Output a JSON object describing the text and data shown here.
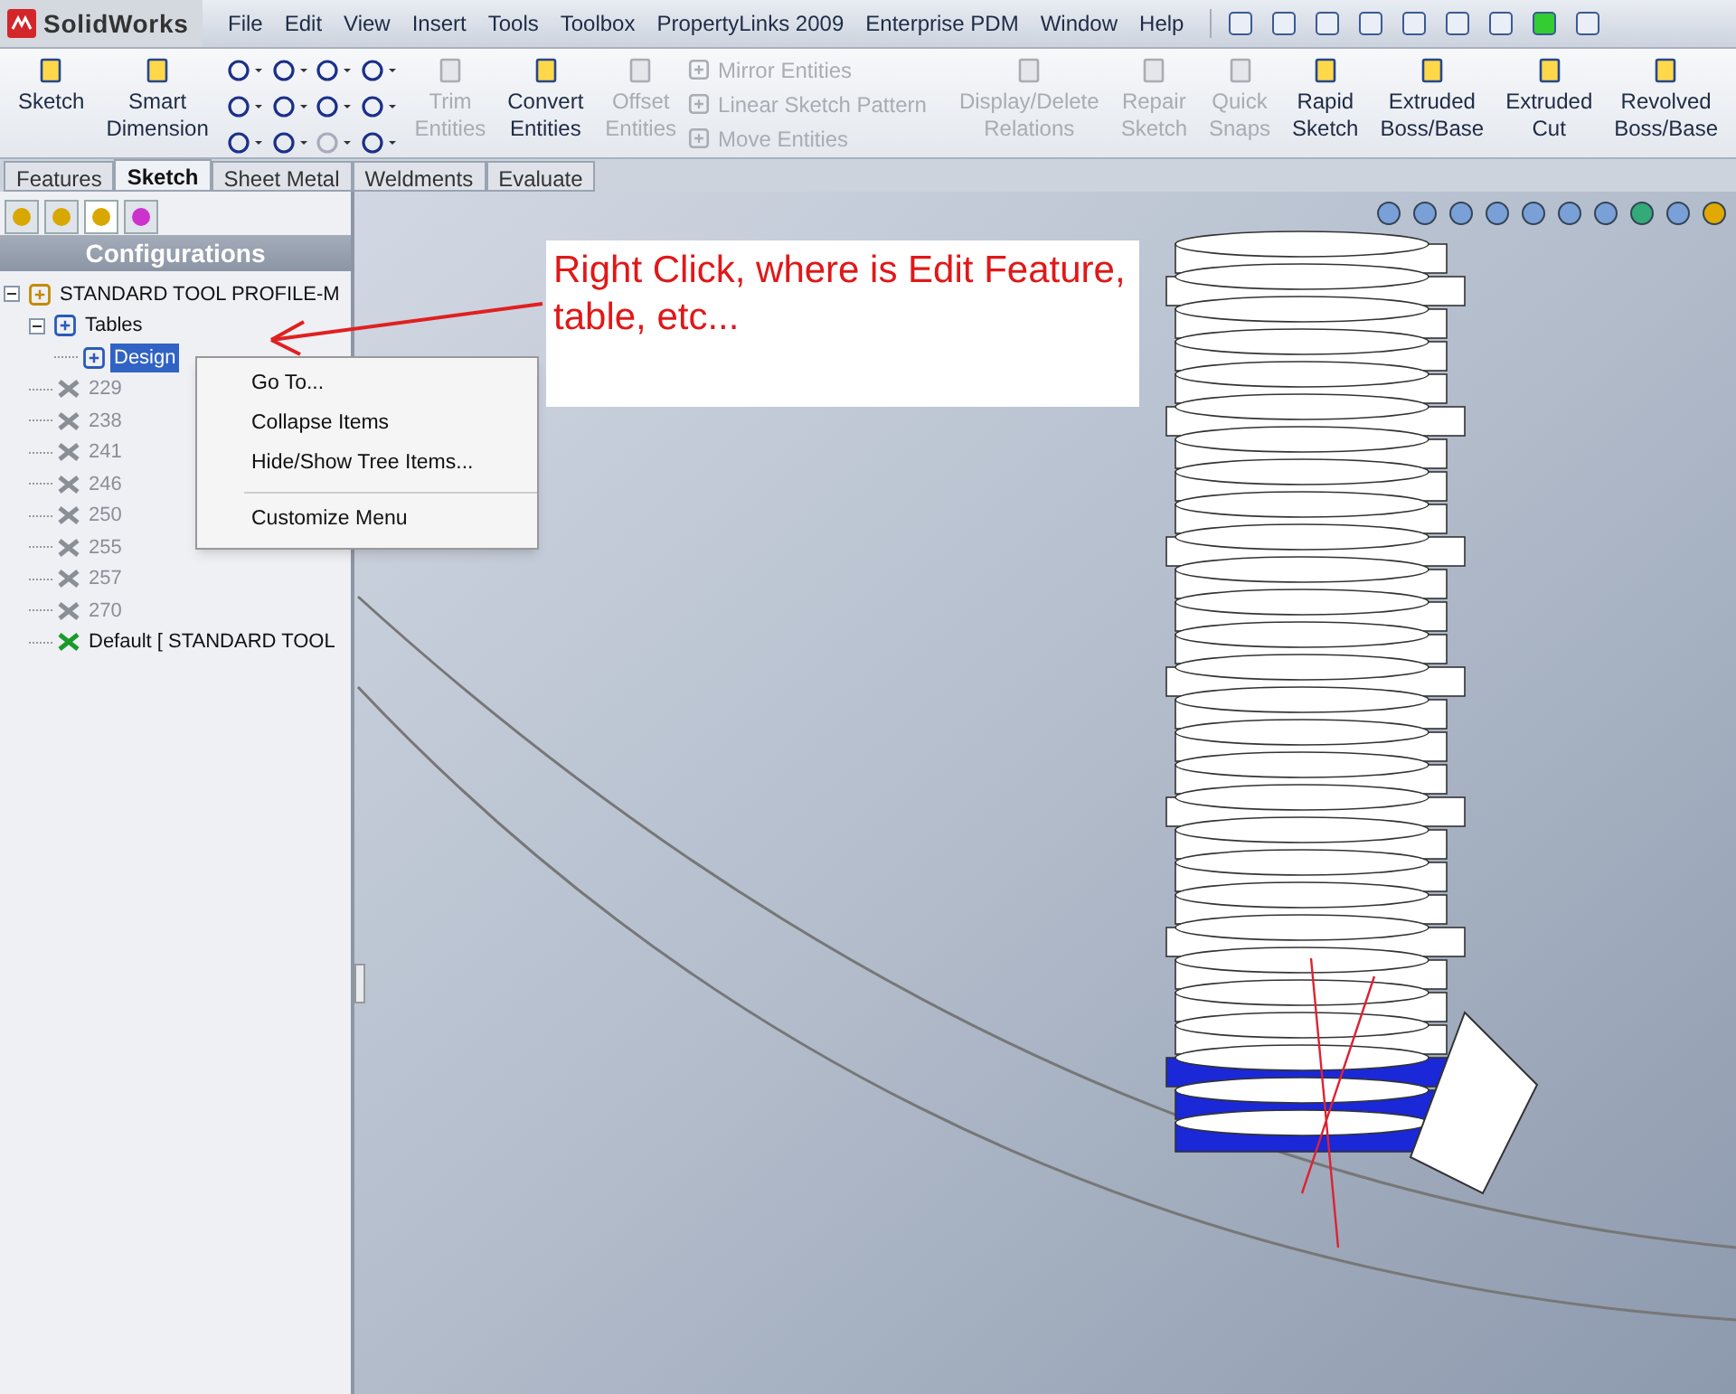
{
  "app": {
    "logo": "SolidWorks"
  },
  "menu": [
    "File",
    "Edit",
    "View",
    "Insert",
    "Tools",
    "Toolbox",
    "PropertyLinks 2009",
    "Enterprise PDM",
    "Window",
    "Help"
  ],
  "ribbon": [
    {
      "kind": "large",
      "label": "Sketch",
      "disabled": false
    },
    {
      "kind": "large",
      "label": "Smart\nDimension",
      "disabled": false
    },
    {
      "kind": "grid"
    },
    {
      "kind": "large",
      "label": "Trim\nEntities",
      "disabled": true
    },
    {
      "kind": "large",
      "label": "Convert\nEntities",
      "disabled": false
    },
    {
      "kind": "large",
      "label": "Offset\nEntities",
      "disabled": true
    },
    {
      "kind": "small",
      "items": [
        {
          "label": "Mirror Entities",
          "disabled": true
        },
        {
          "label": "Linear Sketch Pattern",
          "disabled": true
        },
        {
          "label": "Move Entities",
          "disabled": true
        }
      ]
    },
    {
      "kind": "large",
      "label": "Display/Delete\nRelations",
      "disabled": true
    },
    {
      "kind": "large",
      "label": "Repair\nSketch",
      "disabled": true
    },
    {
      "kind": "large",
      "label": "Quick\nSnaps",
      "disabled": true
    },
    {
      "kind": "large",
      "label": "Rapid\nSketch",
      "disabled": false
    },
    {
      "kind": "large",
      "label": "Extruded\nBoss/Base",
      "disabled": false
    },
    {
      "kind": "large",
      "label": "Extruded\nCut",
      "disabled": false
    },
    {
      "kind": "large",
      "label": "Revolved\nBoss/Base",
      "disabled": false
    }
  ],
  "tabs": [
    {
      "label": "Features",
      "selected": false
    },
    {
      "label": "Sketch",
      "selected": true
    },
    {
      "label": "Sheet Metal",
      "selected": false
    },
    {
      "label": "Weldments",
      "selected": false
    },
    {
      "label": "Evaluate",
      "selected": false
    }
  ],
  "panel": {
    "title": "Configurations",
    "tree": [
      {
        "label": "STANDARD TOOL PROFILE-M",
        "expanded": true,
        "children": [
          {
            "label": "Tables",
            "expanded": true,
            "children": [
              {
                "label": "Design",
                "selected": true
              }
            ]
          },
          {
            "label": "229",
            "active": false
          },
          {
            "label": "238",
            "active": false
          },
          {
            "label": "241",
            "active": false
          },
          {
            "label": "246",
            "active": false
          },
          {
            "label": "250",
            "active": false
          },
          {
            "label": "255",
            "active": false
          },
          {
            "label": "257",
            "active": false
          },
          {
            "label": "270",
            "active": false
          },
          {
            "label": "Default [ STANDARD TOOL",
            "active": true
          }
        ]
      }
    ]
  },
  "context_menu": [
    "Go To...",
    "Collapse Items",
    "Hide/Show Tree Items...",
    "Customize Menu"
  ],
  "annotation": "Right Click, where is Edit Feature, table, etc..."
}
